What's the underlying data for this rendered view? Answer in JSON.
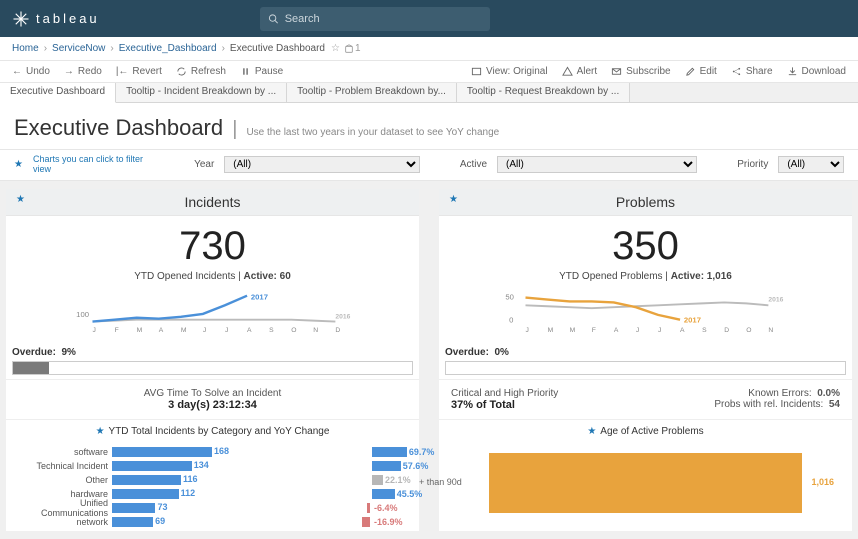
{
  "app": {
    "name": "tableau"
  },
  "search": {
    "placeholder": "Search"
  },
  "breadcrumb": {
    "items": [
      "Home",
      "ServiceNow",
      "Executive_Dashboard"
    ],
    "current": "Executive Dashboard",
    "views": "1"
  },
  "toolbar": {
    "undo": "Undo",
    "redo": "Redo",
    "revert": "Revert",
    "refresh": "Refresh",
    "pause": "Pause",
    "view": "View: Original",
    "alert": "Alert",
    "subscribe": "Subscribe",
    "edit": "Edit",
    "share": "Share",
    "download": "Download"
  },
  "tabs": [
    "Executive Dashboard",
    "Tooltip - Incident Breakdown by ...",
    "Tooltip - Problem Breakdown by...",
    "Tooltip - Request Breakdown by ..."
  ],
  "title": {
    "main": "Executive Dashboard",
    "sub": "Use the last two years in your dataset to see YoY change"
  },
  "filters": {
    "hint": "Charts you can click to filter view",
    "year_label": "Year",
    "year_value": "(All)",
    "active_label": "Active",
    "active_value": "(All)",
    "priority_label": "Priority",
    "priority_value": "(All)"
  },
  "incidents": {
    "header": "Incidents",
    "big": "730",
    "sub_prefix": "YTD Opened Incidents | ",
    "sub_bold": "Active: 60",
    "months": [
      "J",
      "F",
      "M",
      "A",
      "M",
      "J",
      "J",
      "A",
      "S",
      "O",
      "N",
      "D"
    ],
    "yaxis": "100",
    "year_current": "2017",
    "year_prev": "2016",
    "overdue_label": "Overdue:",
    "overdue_value": "9%",
    "overdue_pct": 9,
    "avg_label": "AVG Time To Solve an Incident",
    "avg_value": "3 day(s) 23:12:34",
    "cat_header": "YTD Total Incidents by Category and YoY Change",
    "categories": [
      {
        "label": "software",
        "val": 168,
        "yoy": 69.7,
        "color": "#4a90d9"
      },
      {
        "label": "Technical Incident",
        "val": 134,
        "yoy": 57.6,
        "color": "#4a90d9"
      },
      {
        "label": "Other",
        "val": 116,
        "yoy": 22.1,
        "color": "#b7b7b7"
      },
      {
        "label": "hardware",
        "val": 112,
        "yoy": 45.5,
        "color": "#4a90d9"
      },
      {
        "label": "Unified Communications",
        "val": 73,
        "yoy": -6.4,
        "color": "#d87a7a"
      },
      {
        "label": "network",
        "val": 69,
        "yoy": -16.9,
        "color": "#d87a7a"
      }
    ]
  },
  "problems": {
    "header": "Problems",
    "big": "350",
    "sub_prefix": "YTD Opened Problems | ",
    "sub_bold": "Active: 1,016",
    "months": [
      "J",
      "M",
      "M",
      "F",
      "A",
      "J",
      "J",
      "A",
      "S",
      "D",
      "O",
      "N"
    ],
    "yaxis_top": "50",
    "yaxis_bot": "0",
    "year_current": "2017",
    "year_prev": "2016",
    "overdue_label": "Overdue:",
    "overdue_value": "0%",
    "overdue_pct": 0,
    "crit_label": "Critical and High Priority",
    "crit_value": "37% of Total",
    "known_label": "Known Errors:",
    "known_value": "0.0%",
    "rel_label": "Probs with rel. Incidents:",
    "rel_value": "54",
    "age_header": "Age of Active Problems",
    "age_label": "+ than 90d",
    "age_value": "1,016"
  },
  "chart_data": {
    "incidents_trend": {
      "type": "line",
      "categories": [
        "J",
        "F",
        "M",
        "A",
        "M",
        "J",
        "J",
        "A",
        "S",
        "O",
        "N",
        "D"
      ],
      "series": [
        {
          "name": "2017",
          "values": [
            55,
            58,
            62,
            60,
            65,
            70,
            90,
            120,
            null,
            null,
            null,
            null
          ]
        },
        {
          "name": "2016",
          "values": [
            55,
            56,
            58,
            57,
            56,
            55,
            54,
            55,
            54,
            53,
            52,
            50
          ]
        }
      ],
      "ylim": [
        0,
        130
      ]
    },
    "problems_trend": {
      "type": "line",
      "categories": [
        "J",
        "F",
        "M",
        "A",
        "M",
        "J",
        "J",
        "A",
        "S",
        "O",
        "N",
        "D"
      ],
      "series": [
        {
          "name": "2017",
          "values": [
            48,
            45,
            42,
            40,
            38,
            30,
            18,
            10,
            null,
            null,
            null,
            null
          ]
        },
        {
          "name": "2016",
          "values": [
            40,
            38,
            36,
            35,
            34,
            35,
            36,
            38,
            40,
            42,
            40,
            38
          ]
        }
      ],
      "ylim": [
        0,
        55
      ]
    },
    "incidents_by_category": {
      "type": "bar",
      "categories": [
        "software",
        "Technical Incident",
        "Other",
        "hardware",
        "Unified Communications",
        "network"
      ],
      "series": [
        {
          "name": "YTD Total",
          "values": [
            168,
            134,
            116,
            112,
            73,
            69
          ]
        },
        {
          "name": "YoY Change %",
          "values": [
            69.7,
            57.6,
            22.1,
            45.5,
            -6.4,
            -16.9
          ]
        }
      ]
    },
    "age_of_active_problems": {
      "type": "bar",
      "categories": [
        "+ than 90d"
      ],
      "values": [
        1016
      ]
    }
  }
}
